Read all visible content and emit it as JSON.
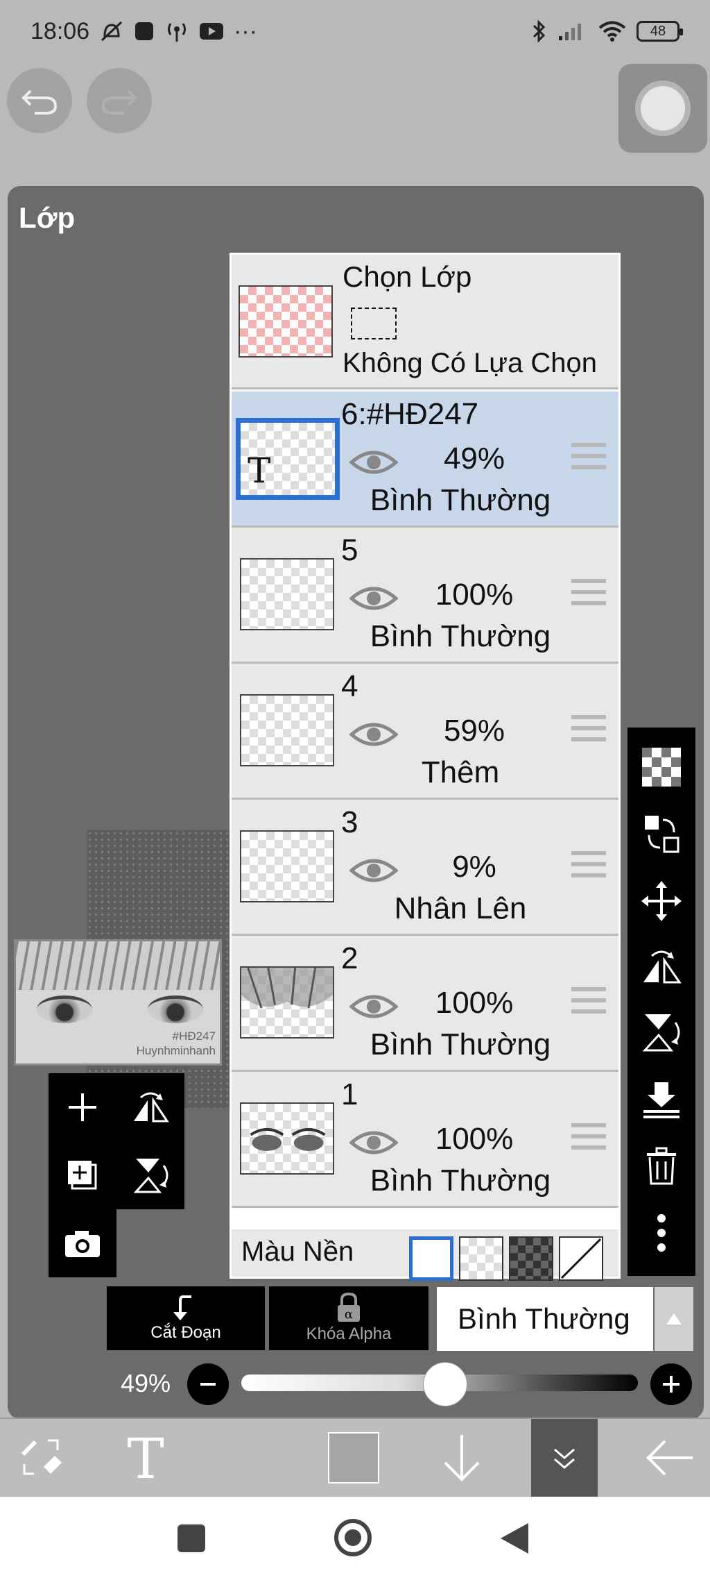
{
  "status_bar": {
    "time": "18:06",
    "battery": "48"
  },
  "panel": {
    "title": "Lớp"
  },
  "preview": {
    "watermark_line1": "#HĐ247",
    "watermark_line2": "Huynhminhanh"
  },
  "selection_row": {
    "title": "Chọn Lớp",
    "subtitle": "Không Có Lựa Chọn"
  },
  "layers": [
    {
      "name": "6:#HĐ247",
      "opacity": "49%",
      "blend": "Bình Thường",
      "active": true
    },
    {
      "name": "5",
      "opacity": "100%",
      "blend": "Bình Thường",
      "active": false
    },
    {
      "name": "4",
      "opacity": "59%",
      "blend": "Thêm",
      "active": false
    },
    {
      "name": "3",
      "opacity": "9%",
      "blend": "Nhân Lên",
      "active": false
    },
    {
      "name": "2",
      "opacity": "100%",
      "blend": "Bình Thường",
      "active": false
    },
    {
      "name": "1",
      "opacity": "100%",
      "blend": "Bình Thường",
      "active": false
    }
  ],
  "background_row": {
    "label": "Màu Nền"
  },
  "controls": {
    "clip_label": "Cắt Đoạn",
    "alpha_lock_label": "Khóa Alpha",
    "blend_mode": "Bình Thường",
    "opacity_label": "49%",
    "opacity_value": 0.49
  },
  "icons": {
    "right_toolbar": [
      "checker-icon",
      "swap-layer-icon",
      "move-icon",
      "flip-horizontal-icon",
      "flip-vertical-icon",
      "merge-down-icon",
      "trash-icon",
      "more-icon"
    ],
    "left_tools": [
      "add-layer-icon",
      "flip-h-icon",
      "add-copy-icon",
      "flip-v-icon",
      "camera-icon"
    ]
  },
  "colors": {
    "active_layer_bg": "#c8d6ea",
    "accent": "#2a6fd3"
  }
}
